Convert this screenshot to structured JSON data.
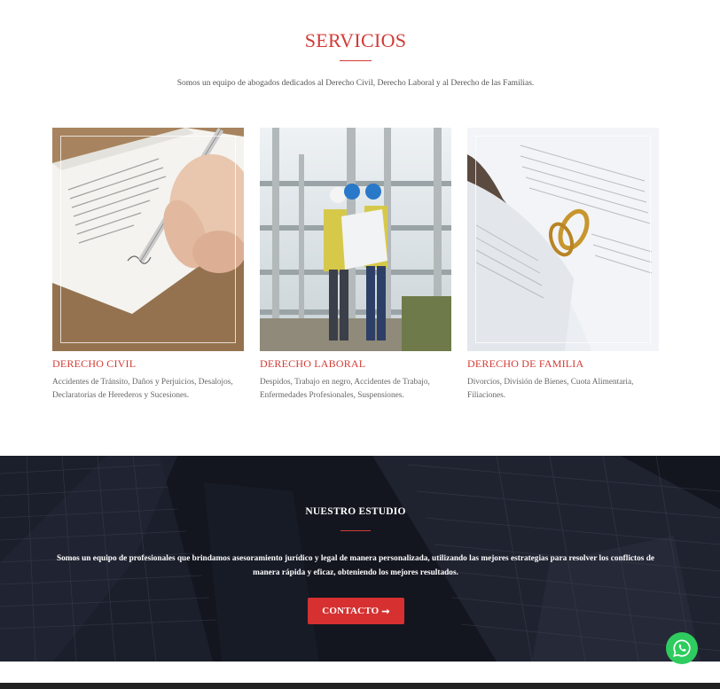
{
  "servicios": {
    "title": "SERVICIOS",
    "subtitle": "Somos un equipo de abogados dedicados al Derecho Civil, Derecho Laboral y al Derecho de las Familias.",
    "accent_color": "#d23b36",
    "cards": [
      {
        "title": "DERECHO CIVIL",
        "description": "Accidentes de Tránsito, Daños y Perjuicios, Desalojos, Declaratorias de Herederos y Sucesiones."
      },
      {
        "title": "DERECHO LABORAL",
        "description": "Despidos, Trabajo en negro, Accidentes de Trabajo, Enfermedades Profesionales, Suspensiones."
      },
      {
        "title": "DERECHO DE FAMILIA",
        "description": "Divorcios, División de Bienes, Cuota Alimentaria, Filiaciones."
      }
    ]
  },
  "estudio": {
    "title": "NUESTRO ESTUDIO",
    "text": "Somos un equipo de profesionales que brindamos asesoramiento jurídico y legal de manera personalizada, utilizando las mejores estrategias para resolver los conflictos de manera rápida y eficaz, obteniendo los mejores resultados.",
    "button_label": "CONTACTO",
    "button_icon": "arrow-right-icon",
    "button_color": "#d63030"
  },
  "whatsapp": {
    "icon": "whatsapp-icon",
    "color": "#2ecc5e"
  }
}
